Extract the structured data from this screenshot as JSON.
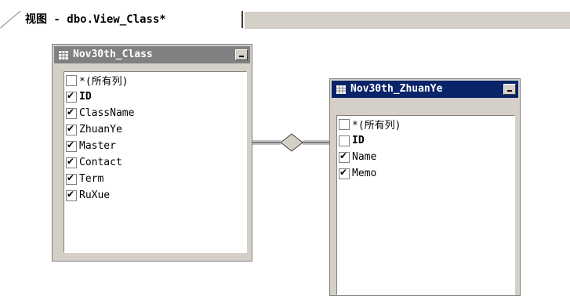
{
  "tab": {
    "title": "视图 - dbo.View_Class*"
  },
  "tables": [
    {
      "title": "Nov30th_Class",
      "active": false,
      "columns": [
        {
          "label": "*(所有列)",
          "checked": false,
          "bold": false
        },
        {
          "label": "ID",
          "checked": true,
          "bold": true
        },
        {
          "label": "ClassName",
          "checked": true,
          "bold": false
        },
        {
          "label": "ZhuanYe",
          "checked": true,
          "bold": false
        },
        {
          "label": "Master",
          "checked": true,
          "bold": false
        },
        {
          "label": "Contact",
          "checked": true,
          "bold": false
        },
        {
          "label": "Term",
          "checked": true,
          "bold": false
        },
        {
          "label": "RuXue",
          "checked": true,
          "bold": false
        }
      ]
    },
    {
      "title": "Nov30th_ZhuanYe",
      "active": true,
      "columns": [
        {
          "label": "*(所有列)",
          "checked": false,
          "bold": false
        },
        {
          "label": "ID",
          "checked": false,
          "bold": true
        },
        {
          "label": "Name",
          "checked": true,
          "bold": false
        },
        {
          "label": "Memo",
          "checked": true,
          "bold": false
        }
      ]
    }
  ],
  "colors": {
    "inactive_title": "#808080",
    "active_title": "#0a246a",
    "chrome": "#d4d0c8"
  },
  "icons": [
    "table-grid-icon",
    "minimize-icon",
    "checkmark-icon",
    "join-diamond-icon"
  ]
}
